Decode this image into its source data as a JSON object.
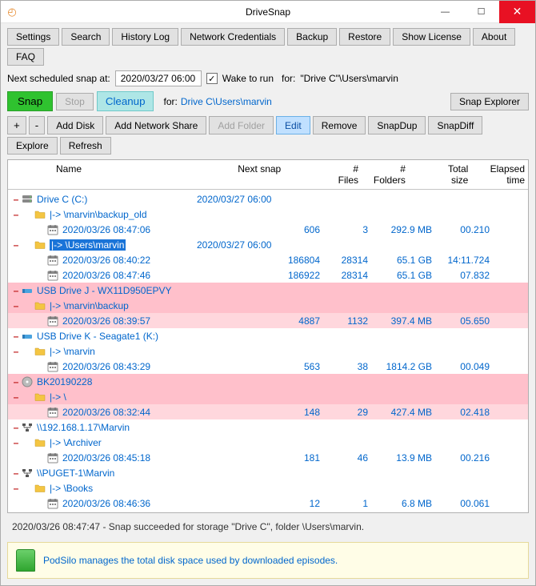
{
  "window": {
    "title": "DriveSnap"
  },
  "toolbar1": {
    "settings": "Settings",
    "search": "Search",
    "history": "History Log",
    "netcreds": "Network Credentials",
    "backup": "Backup",
    "restore": "Restore",
    "license": "Show License",
    "about": "About",
    "faq": "FAQ"
  },
  "schedule": {
    "label": "Next scheduled snap at:",
    "value": "2020/03/27 06:00",
    "wake": "Wake to run",
    "for": "for:",
    "target": "\"Drive C\"\\Users\\marvin"
  },
  "actions": {
    "snap": "Snap",
    "stop": "Stop",
    "cleanup": "Cleanup",
    "for": "for:",
    "target": "Drive C\\Users\\marvin",
    "explorer": "Snap Explorer"
  },
  "toolbar2": {
    "plus": "+",
    "minus": "-",
    "adddisk": "Add Disk",
    "addshare": "Add Network Share",
    "addfolder": "Add Folder",
    "edit": "Edit",
    "remove": "Remove",
    "snapdup": "SnapDup",
    "snapdiff": "SnapDiff",
    "explore": "Explore",
    "refresh": "Refresh"
  },
  "columns": {
    "name": "Name",
    "next": "Next snap",
    "files": "#\nFiles",
    "folders": "#\nFolders",
    "size": "Total\nsize",
    "elapsed": "Elapsed\ntime"
  },
  "rows": [
    {
      "type": "drive",
      "icon": "disk",
      "label": "Drive C (C:)",
      "next": "2020/03/27 06:00",
      "pink": false
    },
    {
      "type": "folder",
      "icon": "folder",
      "indent": 1,
      "label": "|-> \\marvin\\backup_old",
      "pink": false
    },
    {
      "type": "snap",
      "icon": "cal",
      "indent": 2,
      "label": "2020/03/26 08:47:06",
      "files": "606",
      "folders": "3",
      "size": "292.9 MB",
      "elapsed": "00.210"
    },
    {
      "type": "folder",
      "icon": "folder",
      "indent": 1,
      "label": "|-> \\Users\\marvin",
      "next": "2020/03/27 06:00",
      "selected": true,
      "pink": false
    },
    {
      "type": "snap",
      "icon": "cal",
      "indent": 2,
      "label": "2020/03/26 08:40:22",
      "files": "186804",
      "folders": "28314",
      "size": "65.1 GB",
      "elapsed": "14:11.724"
    },
    {
      "type": "snap",
      "icon": "cal",
      "indent": 2,
      "label": "2020/03/26 08:47:46",
      "files": "186922",
      "folders": "28314",
      "size": "65.1 GB",
      "elapsed": "07.832"
    },
    {
      "type": "drive",
      "icon": "usb",
      "label": "USB Drive J - WX11D950EPVY",
      "pink": true
    },
    {
      "type": "folder",
      "icon": "folder",
      "indent": 1,
      "label": "|-> \\marvin\\backup",
      "pink": true
    },
    {
      "type": "snap",
      "icon": "cal",
      "indent": 2,
      "label": "2020/03/26 08:39:57",
      "files": "4887",
      "folders": "1132",
      "size": "397.4 MB",
      "elapsed": "05.650",
      "pink": true,
      "childpink": true
    },
    {
      "type": "drive",
      "icon": "usb",
      "label": "USB Drive K - Seagate1 (K:)",
      "pink": false
    },
    {
      "type": "folder",
      "icon": "folder",
      "indent": 1,
      "label": "|-> \\marvin",
      "pink": false
    },
    {
      "type": "snap",
      "icon": "cal",
      "indent": 2,
      "label": "2020/03/26 08:43:29",
      "files": "563",
      "folders": "38",
      "size": "1814.2 GB",
      "elapsed": "00.049"
    },
    {
      "type": "drive",
      "icon": "cd",
      "label": "BK20190228",
      "pink": true
    },
    {
      "type": "folder",
      "icon": "folder",
      "indent": 1,
      "label": "|-> \\",
      "pink": true
    },
    {
      "type": "snap",
      "icon": "cal",
      "indent": 2,
      "label": "2020/03/26 08:32:44",
      "files": "148",
      "folders": "29",
      "size": "427.4 MB",
      "elapsed": "02.418",
      "pink": true,
      "childpink": true
    },
    {
      "type": "drive",
      "icon": "net",
      "label": "\\\\192.168.1.17\\Marvin",
      "pink": false
    },
    {
      "type": "folder",
      "icon": "folder",
      "indent": 1,
      "label": "|-> \\Archiver",
      "pink": false
    },
    {
      "type": "snap",
      "icon": "cal",
      "indent": 2,
      "label": "2020/03/26 08:45:18",
      "files": "181",
      "folders": "46",
      "size": "13.9 MB",
      "elapsed": "00.216"
    },
    {
      "type": "drive",
      "icon": "net",
      "label": "\\\\PUGET-1\\Marvin",
      "pink": false
    },
    {
      "type": "folder",
      "icon": "folder",
      "indent": 1,
      "label": "|-> \\Books",
      "pink": false
    },
    {
      "type": "snap",
      "icon": "cal",
      "indent": 2,
      "label": "2020/03/26 08:46:36",
      "files": "12",
      "folders": "1",
      "size": "6.8 MB",
      "elapsed": "00.061"
    }
  ],
  "status": "2020/03/26 08:47:47 - Snap succeeded for storage \"Drive C\", folder \\Users\\marvin.",
  "tip": "PodSilo manages the total disk space used by downloaded episodes."
}
